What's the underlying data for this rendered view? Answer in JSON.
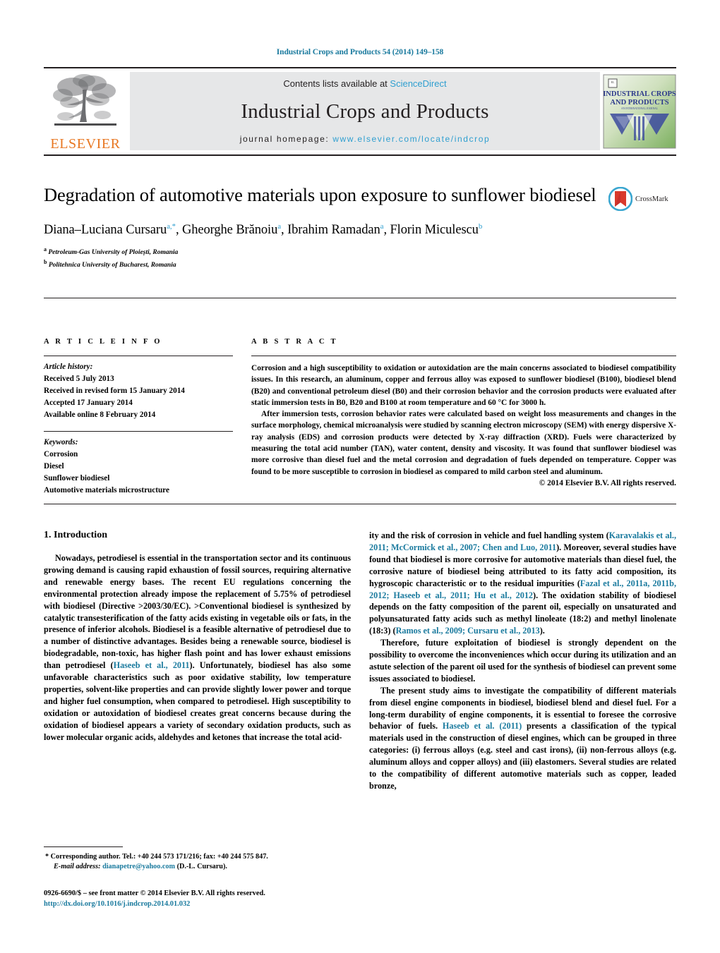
{
  "running_head": "Industrial Crops and Products 54 (2014) 149–158",
  "masthead": {
    "contents_prefix": "Contents lists available at ",
    "sciencedirect": "ScienceDirect",
    "journal_title": "Industrial Crops and Products",
    "homepage_prefix": "journal homepage: ",
    "homepage_url": "www.elsevier.com/locate/indcrop",
    "publisher": "ELSEVIER",
    "cover_title_line1": "INDUSTRIAL CROPS",
    "cover_title_line2": "AND PRODUCTS",
    "cover_subtitle": "AN INTERNATIONAL JOURNAL"
  },
  "article": {
    "title": "Degradation of automotive materials upon exposure to sunflower biodiesel",
    "crossmark_label": "CrossMark",
    "authors_html": "Diana–Luciana Cursaru<sup>a,*</sup>, Gheorghe Brănoiu<sup>a</sup>, Ibrahim Ramadan<sup>a</sup>, Florin Miculescu<sup>b</sup>",
    "affiliation_a": "Petroleum-Gas University of Ploiești, Romania",
    "affiliation_b": "Politehnica University of Bucharest, Romania"
  },
  "article_info": {
    "heading": "A R T I C L E   I N F O",
    "history_label": "Article history:",
    "history": [
      "Received 5 July 2013",
      "Received in revised form 15 January 2014",
      "Accepted 17 January 2014",
      "Available online 8 February 2014"
    ],
    "keywords_label": "Keywords:",
    "keywords": [
      "Corrosion",
      "Diesel",
      "Sunflower biodiesel",
      "Automotive materials microstructure"
    ]
  },
  "abstract": {
    "heading": "A B S T R A C T",
    "paragraph1": "Corrosion and a high susceptibility to oxidation or autoxidation are the main concerns associated to biodiesel compatibility issues. In this research, an aluminum, copper and ferrous alloy was exposed to sunflower biodiesel (B100), biodiesel blend (B20) and conventional petroleum diesel (B0) and their corrosion behavior and the corrosion products were evaluated after static immersion tests in B0, B20 and B100 at room temperature and 60 °C for 3000 h.",
    "paragraph2": "After immersion tests, corrosion behavior rates were calculated based on weight loss measurements and changes in the surface morphology, chemical microanalysis were studied by scanning electron microscopy (SEM) with energy dispersive X-ray analysis (EDS) and corrosion products were detected by X-ray diffraction (XRD). Fuels were characterized by measuring the total acid number (TAN), water content, density and viscosity. It was found that sunflower biodiesel was more corrosive than diesel fuel and the metal corrosion and degradation of fuels depended on temperature. Copper was found to be more susceptible to corrosion in biodiesel as compared to mild carbon steel and aluminum.",
    "copyright": "© 2014 Elsevier B.V. All rights reserved."
  },
  "body": {
    "section_number_title": "1.  Introduction",
    "left_p1_a": "Nowadays, petrodiesel is essential in the transportation sector and its continuous growing demand is causing rapid exhaustion of fossil sources, requiring alternative and renewable energy bases. The recent EU regulations concerning the environmental protection already impose the replacement of 5.75% of petrodiesel with biodiesel (Directive >2003/30/EC). >Conventional biodiesel is synthesized by catalytic transesterification of the fatty acids existing in vegetable oils or fats, in the presence of inferior alcohols. Biodiesel is a feasible alternative of petrodiesel due to a number of distinctive advantages. Besides being a renewable source, biodiesel is biodegradable, non-toxic, has higher flash point and has lower exhaust emissions than petrodiesel (",
    "left_ref1": "Haseeb et al., 2011",
    "left_p1_b": "). Unfortunately, biodiesel has also some unfavorable characteristics such as poor oxidative stability, low temperature properties, solvent-like properties and can provide slightly lower power and torque and higher fuel consumption, when compared to petrodiesel. High susceptibility to oxidation or autoxidation of biodiesel creates great concerns because during the oxidation of biodiesel appears a variety of secondary oxidation products, such as lower molecular organic acids, aldehydes and ketones that increase the total acid-",
    "right_p1_a": "ity and the risk of corrosion in vehicle and fuel handling system (",
    "right_ref1": "Karavalakis et al., 2011; McCormick et al., 2007; Chen and Luo, 2011",
    "right_p1_b": "). Moreover, several studies have found that biodiesel is more corrosive for automotive materials than diesel fuel, the corrosive nature of biodiesel being attributed to its fatty acid composition, its hygroscopic characteristic or to the residual impurities (",
    "right_ref2": "Fazal et al., 2011a, 2011b, 2012; Haseeb et al., 2011; Hu et al., 2012",
    "right_p1_c": "). The oxidation stability of biodiesel depends on the fatty composition of the parent oil, especially on unsaturated and polyunsaturated fatty acids such as methyl linoleate (18:2) and methyl linolenate (18:3) (",
    "right_ref3": "Ramos et al., 2009; Cursaru et al., 2013",
    "right_p1_d": ").",
    "right_p2": "Therefore, future exploitation of biodiesel is strongly dependent on the possibility to overcome the inconveniences which occur during its utilization and an astute selection of the parent oil used for the synthesis of biodiesel can prevent some issues associated to biodiesel.",
    "right_p3_a": "The present study aims to investigate the compatibility of different materials from diesel engine components in biodiesel, biodiesel blend and diesel fuel. For a long-term durability of engine components, it is essential to foresee the corrosive behavior of fuels. ",
    "right_ref4": "Haseeb et al. (2011)",
    "right_p3_b": " presents a classification of the typical materials used in the construction of diesel engines, which can be grouped in three categories: (i) ferrous alloys (e.g. steel and cast irons), (ii) non-ferrous alloys (e.g. aluminum alloys and copper alloys) and (iii) elastomers. Several studies are related to the compatibility of different automotive materials such as copper, leaded bronze,"
  },
  "footer": {
    "corresponding_star": "*",
    "corresponding_text": " Corresponding author. Tel.: +40 244 573 171/216; fax: +40 244 575 847.",
    "email_label": "E-mail address:",
    "email": "dianapetre@yahoo.com",
    "email_suffix": " (D.-L. Cursaru).",
    "issn_line": "0926-6690/$ – see front matter © 2014 Elsevier B.V. All rights reserved.",
    "doi": "http://dx.doi.org/10.1016/j.indcrop.2014.01.032"
  },
  "colors": {
    "link_blue": "#1a7a9e",
    "sciencedirect_blue": "#2f9fd0",
    "elsevier_orange": "#e87722",
    "banner_gray": "#e6e7e8"
  }
}
